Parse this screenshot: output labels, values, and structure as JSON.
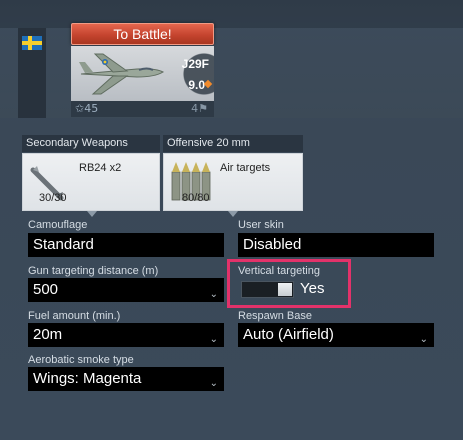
{
  "nation": {
    "flag_icon": "sweden-flag-icon",
    "colors": {
      "blue": "#1f6fb8",
      "yellow": "#f6cf2c"
    }
  },
  "battle_button": {
    "label": "To Battle!"
  },
  "vehicle": {
    "name": "J29F",
    "battle_rating": "9.0",
    "rank_icon": "rank-star-icon",
    "rank": "45",
    "crew": "4"
  },
  "weapons": {
    "secondary": {
      "header": "Secondary Weapons",
      "name": "RB24 x2",
      "ammo": "30/30",
      "icon": "missile-icon"
    },
    "offensive": {
      "header": "Offensive 20 mm",
      "name": "Air targets",
      "ammo": "80/80",
      "icon": "cannon-rounds-icon"
    }
  },
  "settings": {
    "camouflage": {
      "label": "Camouflage",
      "value": "Standard"
    },
    "user_skin": {
      "label": "User skin",
      "value": "Disabled"
    },
    "gun_targeting": {
      "label": "Gun targeting distance (m)",
      "value": "500"
    },
    "vertical_targeting": {
      "label": "Vertical targeting",
      "value": "Yes"
    },
    "fuel": {
      "label": "Fuel amount (min.)",
      "value": "20m"
    },
    "respawn": {
      "label": "Respawn Base",
      "value": "Auto (Airfield)"
    },
    "smoke": {
      "label": "Aerobatic smoke type",
      "value": "Wings: Magenta"
    }
  },
  "highlight_color": "#e3326a"
}
